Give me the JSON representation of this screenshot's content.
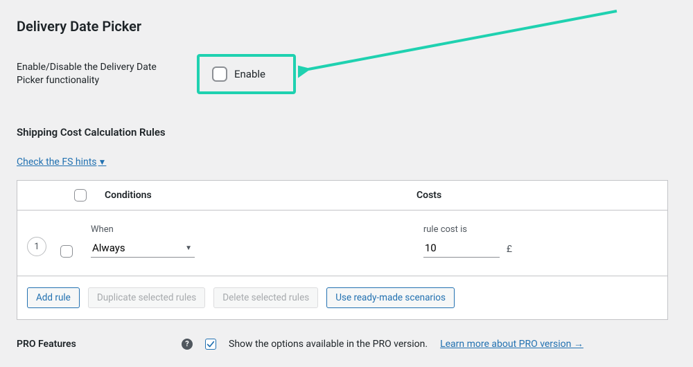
{
  "page_title": "Delivery Date Picker",
  "enable_row": {
    "label": "Enable/Disable the Delivery Date Picker functionality",
    "checkbox_label": "Enable"
  },
  "rules_section_title": "Shipping Cost Calculation Rules",
  "hints_link": "Check the FS hints",
  "table": {
    "head_conditions": "Conditions",
    "head_costs": "Costs",
    "row_number": "1",
    "when_label": "When",
    "when_value": "Always",
    "cost_label": "rule cost is",
    "cost_value": "10",
    "currency": "£"
  },
  "buttons": {
    "add": "Add rule",
    "dup": "Duplicate selected rules",
    "del": "Delete selected rules",
    "scenarios": "Use ready-made scenarios"
  },
  "pro": {
    "label": "PRO Features",
    "text": "Show the options available in the PRO version.",
    "link": "Learn more about PRO version →"
  },
  "annotation": {
    "color": "#1fd1b0"
  }
}
